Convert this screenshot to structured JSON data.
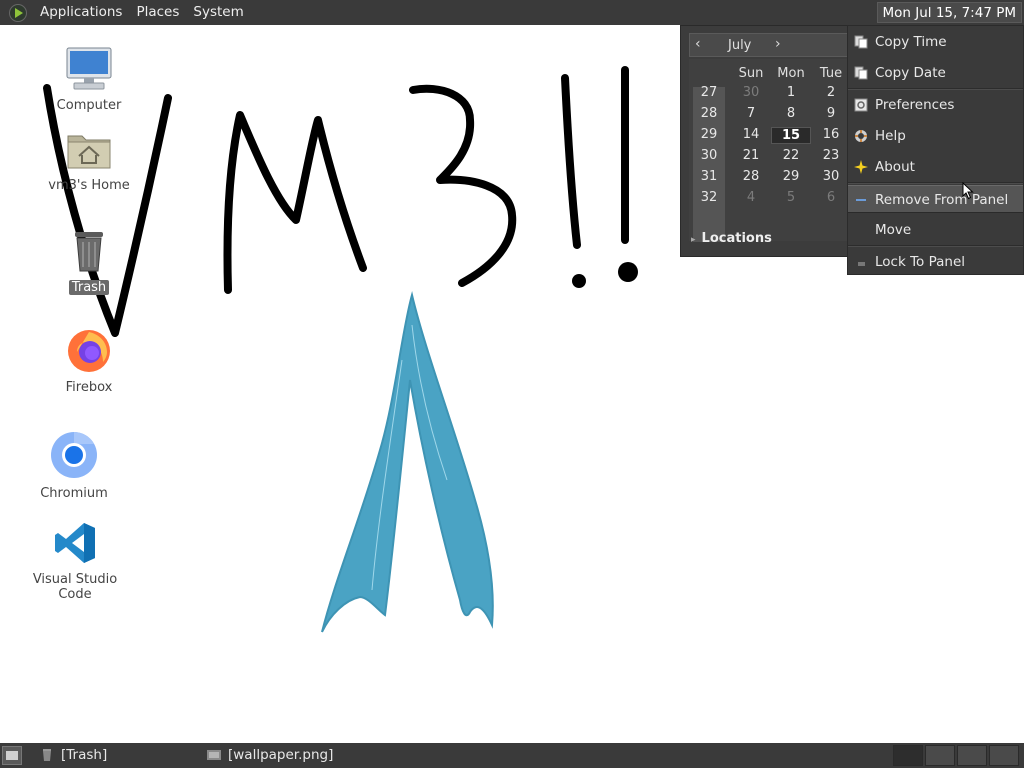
{
  "top_panel": {
    "menus": [
      "Applications",
      "Places",
      "System"
    ],
    "clock": "Mon Jul 15,  7:47 PM"
  },
  "desktop_icons": [
    {
      "label": "Computer",
      "icon": "computer-icon"
    },
    {
      "label": "vm3's Home",
      "icon": "home-folder-icon"
    },
    {
      "label": "Trash",
      "icon": "trash-icon"
    },
    {
      "label": "Firebox",
      "icon": "firefox-icon"
    },
    {
      "label": "Chromium",
      "icon": "chromium-icon"
    },
    {
      "label": "Visual Studio Code",
      "icon": "vscode-icon"
    }
  ],
  "calendar": {
    "month": "July",
    "prev": "‹",
    "next": "›",
    "day_headers": [
      "Sun",
      "Mon",
      "Tue"
    ],
    "weeks": [
      {
        "week": "27",
        "days": [
          "30",
          "1",
          "2"
        ],
        "dim": [
          true,
          false,
          false
        ]
      },
      {
        "week": "28",
        "days": [
          "7",
          "8",
          "9"
        ],
        "dim": [
          false,
          false,
          false
        ]
      },
      {
        "week": "29",
        "days": [
          "14",
          "15",
          "16"
        ],
        "dim": [
          false,
          false,
          false
        ]
      },
      {
        "week": "30",
        "days": [
          "21",
          "22",
          "23"
        ],
        "dim": [
          false,
          false,
          false
        ]
      },
      {
        "week": "31",
        "days": [
          "28",
          "29",
          "30"
        ],
        "dim": [
          false,
          false,
          false
        ]
      },
      {
        "week": "32",
        "days": [
          "4",
          "5",
          "6"
        ],
        "dim": [
          true,
          true,
          true
        ]
      }
    ],
    "today": "15",
    "locations_label": "Locations"
  },
  "context_menu": {
    "items": [
      {
        "label": "Copy Time",
        "icon": "copy-icon"
      },
      {
        "label": "Copy Date",
        "icon": "copy-icon"
      },
      {
        "label": "Preferences",
        "icon": "preferences-icon"
      },
      {
        "label": "Help",
        "icon": "help-icon"
      },
      {
        "label": "About",
        "icon": "about-icon"
      },
      {
        "label": "Remove From Panel",
        "icon": "remove-icon"
      },
      {
        "label": "Move",
        "icon": ""
      },
      {
        "label": "Lock To Panel",
        "icon": "lock-icon"
      }
    ],
    "highlighted": "Remove From Panel"
  },
  "taskbar": {
    "tasks": [
      {
        "label": "[Trash]",
        "icon": "trash-icon"
      },
      {
        "label": "[wallpaper.png]",
        "icon": "image-icon"
      }
    ]
  },
  "wallpaper": {
    "drawn_text": "VM3!!",
    "ink_color": "#000000",
    "arrow_color": "#3a9bbf"
  }
}
